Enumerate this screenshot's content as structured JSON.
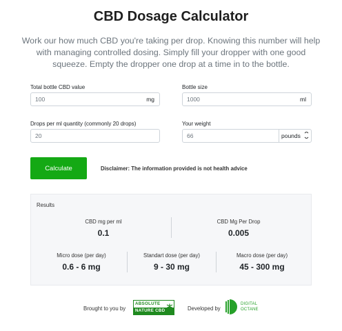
{
  "title": "CBD Dosage Calculator",
  "intro": "Work our how much CBD you're taking per drop. Knowing this number will help with managing controlled dosing. Simply fill your dropper with one good squeeze. Empty the dropper one drop at a time in to the bottle.",
  "fields": {
    "bottle_cbd": {
      "label": "Total bottle CBD value",
      "value": "100",
      "unit": "mg"
    },
    "bottle_size": {
      "label": "Bottle size",
      "value": "1000",
      "unit": "ml"
    },
    "drops_per_ml": {
      "label": "Drops per ml quantity (commonly 20 drops)",
      "value": "20"
    },
    "weight": {
      "label": "Your weight",
      "value": "66",
      "unit_selected": "pounds"
    }
  },
  "calculate_label": "Calculate",
  "disclaimer": "Disclaimer: The information provided is not health advice",
  "results": {
    "label": "Results",
    "cbd_per_ml": {
      "label": "CBD mg per ml",
      "value": "0.1"
    },
    "cbd_per_drop": {
      "label": "CBD Mg Per Drop",
      "value": "0.005"
    },
    "micro": {
      "label": "Micro dose (per day)",
      "value": "0.6 - 6 mg"
    },
    "standard": {
      "label": "Standart dose (per day)",
      "value": "9 - 30 mg"
    },
    "macro": {
      "label": "Macro dose (per day)",
      "value": "45 - 300 mg"
    }
  },
  "footer": {
    "brought_by": "Brought to you by",
    "absolute_logo": {
      "line1": "ABSOLUTE",
      "line2": "NATURE CBD"
    },
    "developed_by": "Developed by",
    "digital_logo": {
      "line1": "DIGITAL",
      "line2": "OCTANE"
    }
  },
  "colors": {
    "accent": "#14a914",
    "logo_green": "#1f8a1f",
    "results_bg": "#f6f7f9"
  },
  "icons": {
    "select_chevron": "chevron-down-icon",
    "leaf": "cannabis-leaf-icon",
    "octane": "digital-octane-mark-icon"
  }
}
